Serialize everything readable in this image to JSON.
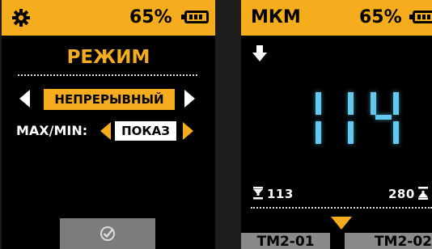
{
  "left_screen": {
    "battery_percent": "65%",
    "title": "РЕЖИМ",
    "mode_value": "НЕПРЕРЫВНЫЙ",
    "maxmin_label": "MAX/MIN:",
    "maxmin_value": "ПОКАЗ",
    "icons": [
      "gear-icon",
      "battery-icon",
      "arrow-left-icon",
      "arrow-right-icon",
      "check-icon"
    ]
  },
  "right_screen": {
    "title": "МКМ",
    "battery_percent": "65%",
    "reading": "114",
    "lower_limit": "113",
    "upper_limit": "280",
    "tabs": [
      "TM2-01",
      "TM2-02"
    ],
    "icons": [
      "down-arrow-icon",
      "lower-limit-icon",
      "upper-limit-icon",
      "tab-pointer-icon",
      "battery-icon"
    ]
  },
  "colors": {
    "accent": "#f5ad1d",
    "screen_bg": "#000000",
    "digit_color": "#63c7ee",
    "tab_bg": "#8a8a8a",
    "device_body": "#1e1d1b"
  }
}
